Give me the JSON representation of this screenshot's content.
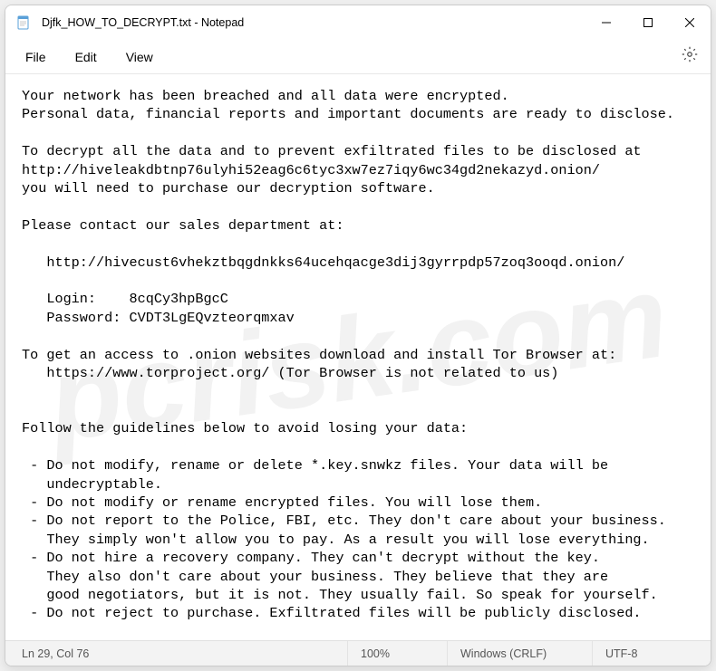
{
  "titlebar": {
    "title": "Djfk_HOW_TO_DECRYPT.txt - Notepad"
  },
  "menubar": {
    "file": "File",
    "edit": "Edit",
    "view": "View"
  },
  "content": {
    "line01": "Your network has been breached and all data were encrypted.",
    "line02": "Personal data, financial reports and important documents are ready to disclose.",
    "line03": "",
    "line04": "To decrypt all the data and to prevent exfiltrated files to be disclosed at",
    "line05": "http://hiveleakdbtnp76ulyhi52eag6c6tyc3xw7ez7iqy6wc34gd2nekazyd.onion/",
    "line06": "you will need to purchase our decryption software.",
    "line07": "",
    "line08": "Please contact our sales department at:",
    "line09": "",
    "line10": "   http://hivecust6vhekztbqgdnkks64ucehqacge3dij3gyrrpdp57zoq3ooqd.onion/",
    "line11": "",
    "line12": "   Login:    8cqCy3hpBgcC",
    "line13": "   Password: CVDT3LgEQvzteorqmxav",
    "line14": "",
    "line15": "To get an access to .onion websites download and install Tor Browser at:",
    "line16": "   https://www.torproject.org/ (Tor Browser is not related to us)",
    "line17": "",
    "line18": "",
    "line19": "Follow the guidelines below to avoid losing your data:",
    "line20": "",
    "line21": " - Do not modify, rename or delete *.key.snwkz files. Your data will be",
    "line22": "   undecryptable.",
    "line23": " - Do not modify or rename encrypted files. You will lose them.",
    "line24": " - Do not report to the Police, FBI, etc. They don't care about your business.",
    "line25": "   They simply won't allow you to pay. As a result you will lose everything.",
    "line26": " - Do not hire a recovery company. They can't decrypt without the key.",
    "line27": "   They also don't care about your business. They believe that they are",
    "line28": "   good negotiators, but it is not. They usually fail. So speak for yourself.",
    "line29": " - Do not reject to purchase. Exfiltrated files will be publicly disclosed."
  },
  "statusbar": {
    "position": "Ln 29, Col 76",
    "zoom": "100%",
    "encoding_mode": "Windows (CRLF)",
    "encoding": "UTF-8"
  },
  "watermark": "pcrisk.com"
}
